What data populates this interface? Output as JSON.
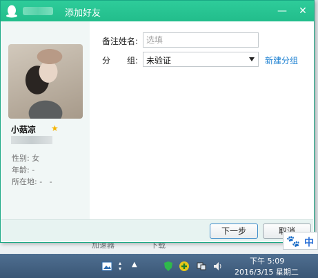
{
  "window": {
    "title": "添加好友",
    "close_glyph": "✕",
    "minimize_glyph": "—"
  },
  "profile": {
    "nickname": "小菇凉",
    "gender_label": "性别:",
    "gender_value": "女",
    "age_label": "年龄:",
    "age_value": "-",
    "location_label": "所在地:",
    "location_value": "-   -"
  },
  "form": {
    "remark_label": "备注姓名:",
    "remark_placeholder": "选填",
    "group_label_1": "分",
    "group_label_2": "组:",
    "group_value": "未验证",
    "new_group_link": "新建分组"
  },
  "footer": {
    "next_label": "下一步",
    "cancel_label": "取消"
  },
  "background_strip": {
    "item_1": "加速器",
    "item_2": "下载"
  },
  "taskbar": {
    "time": "下午 5:09",
    "date": "2016/3/15 星期二"
  },
  "ime": {
    "mode": "中"
  },
  "colors": {
    "titlebar": "#22bd8b",
    "link": "#1a7fd1",
    "left_panel": "#f1f7f6"
  }
}
